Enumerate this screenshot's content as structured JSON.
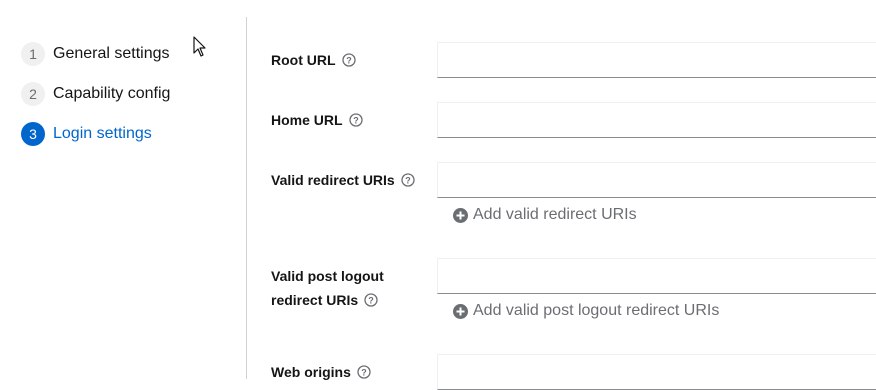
{
  "wizard": {
    "steps": [
      {
        "number": "1",
        "label": "General settings"
      },
      {
        "number": "2",
        "label": "Capability config"
      },
      {
        "number": "3",
        "label": "Login settings"
      }
    ]
  },
  "form": {
    "root_url": {
      "label": "Root URL",
      "value": ""
    },
    "home_url": {
      "label": "Home URL",
      "value": ""
    },
    "valid_redirect_uris": {
      "label": "Valid redirect URIs",
      "value": "",
      "add_label": "Add valid redirect URIs"
    },
    "valid_post_logout": {
      "label_line1": "Valid post logout",
      "label_line2": "redirect URIs",
      "value": "",
      "add_label": "Add valid post logout redirect URIs"
    },
    "web_origins": {
      "label": "Web origins",
      "value": ""
    }
  },
  "icons": {
    "help": "help-icon",
    "add": "plus-circle-icon",
    "cursor": "mouse-pointer-icon"
  },
  "colors": {
    "accent": "#0066cc",
    "muted": "#6a6e73",
    "divider": "#d2d2d2"
  }
}
